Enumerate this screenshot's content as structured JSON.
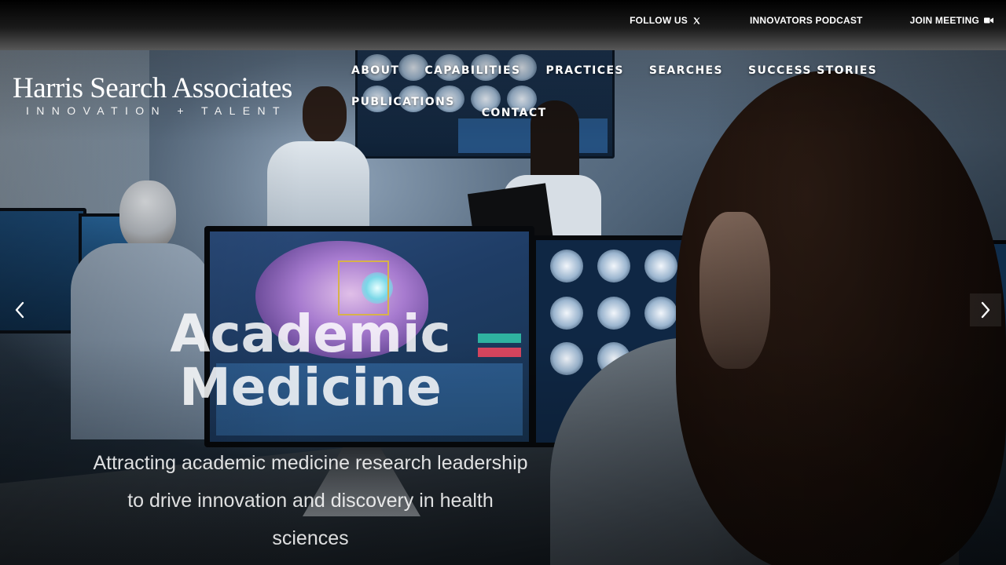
{
  "topbar": {
    "follow_label": "FOLLOW US",
    "follow_icon": "x-logo-icon",
    "podcast_label": "INNOVATORS PODCAST",
    "meeting_label": "JOIN MEETING",
    "meeting_icon": "video-camera-icon"
  },
  "logo": {
    "title": "Harris Search Associates",
    "tagline": "INNOVATION + TALENT"
  },
  "nav": {
    "items": [
      {
        "label": "ABOUT"
      },
      {
        "label": "CAPABILITIES"
      },
      {
        "label": "PRACTICES"
      },
      {
        "label": "SEARCHES"
      },
      {
        "label": "SUCCESS STORIES"
      },
      {
        "label": "PUBLICATIONS"
      },
      {
        "label": "CONTACT"
      }
    ]
  },
  "hero": {
    "title_line1": "Academic",
    "title_line2": "Medicine",
    "subtitle": "Attracting academic medicine research leadership to drive innovation and discovery in health sciences",
    "prev_icon": "chevron-left-icon",
    "next_icon": "chevron-right-icon"
  },
  "colors": {
    "text": "#ffffff",
    "topbar": "#000000"
  }
}
